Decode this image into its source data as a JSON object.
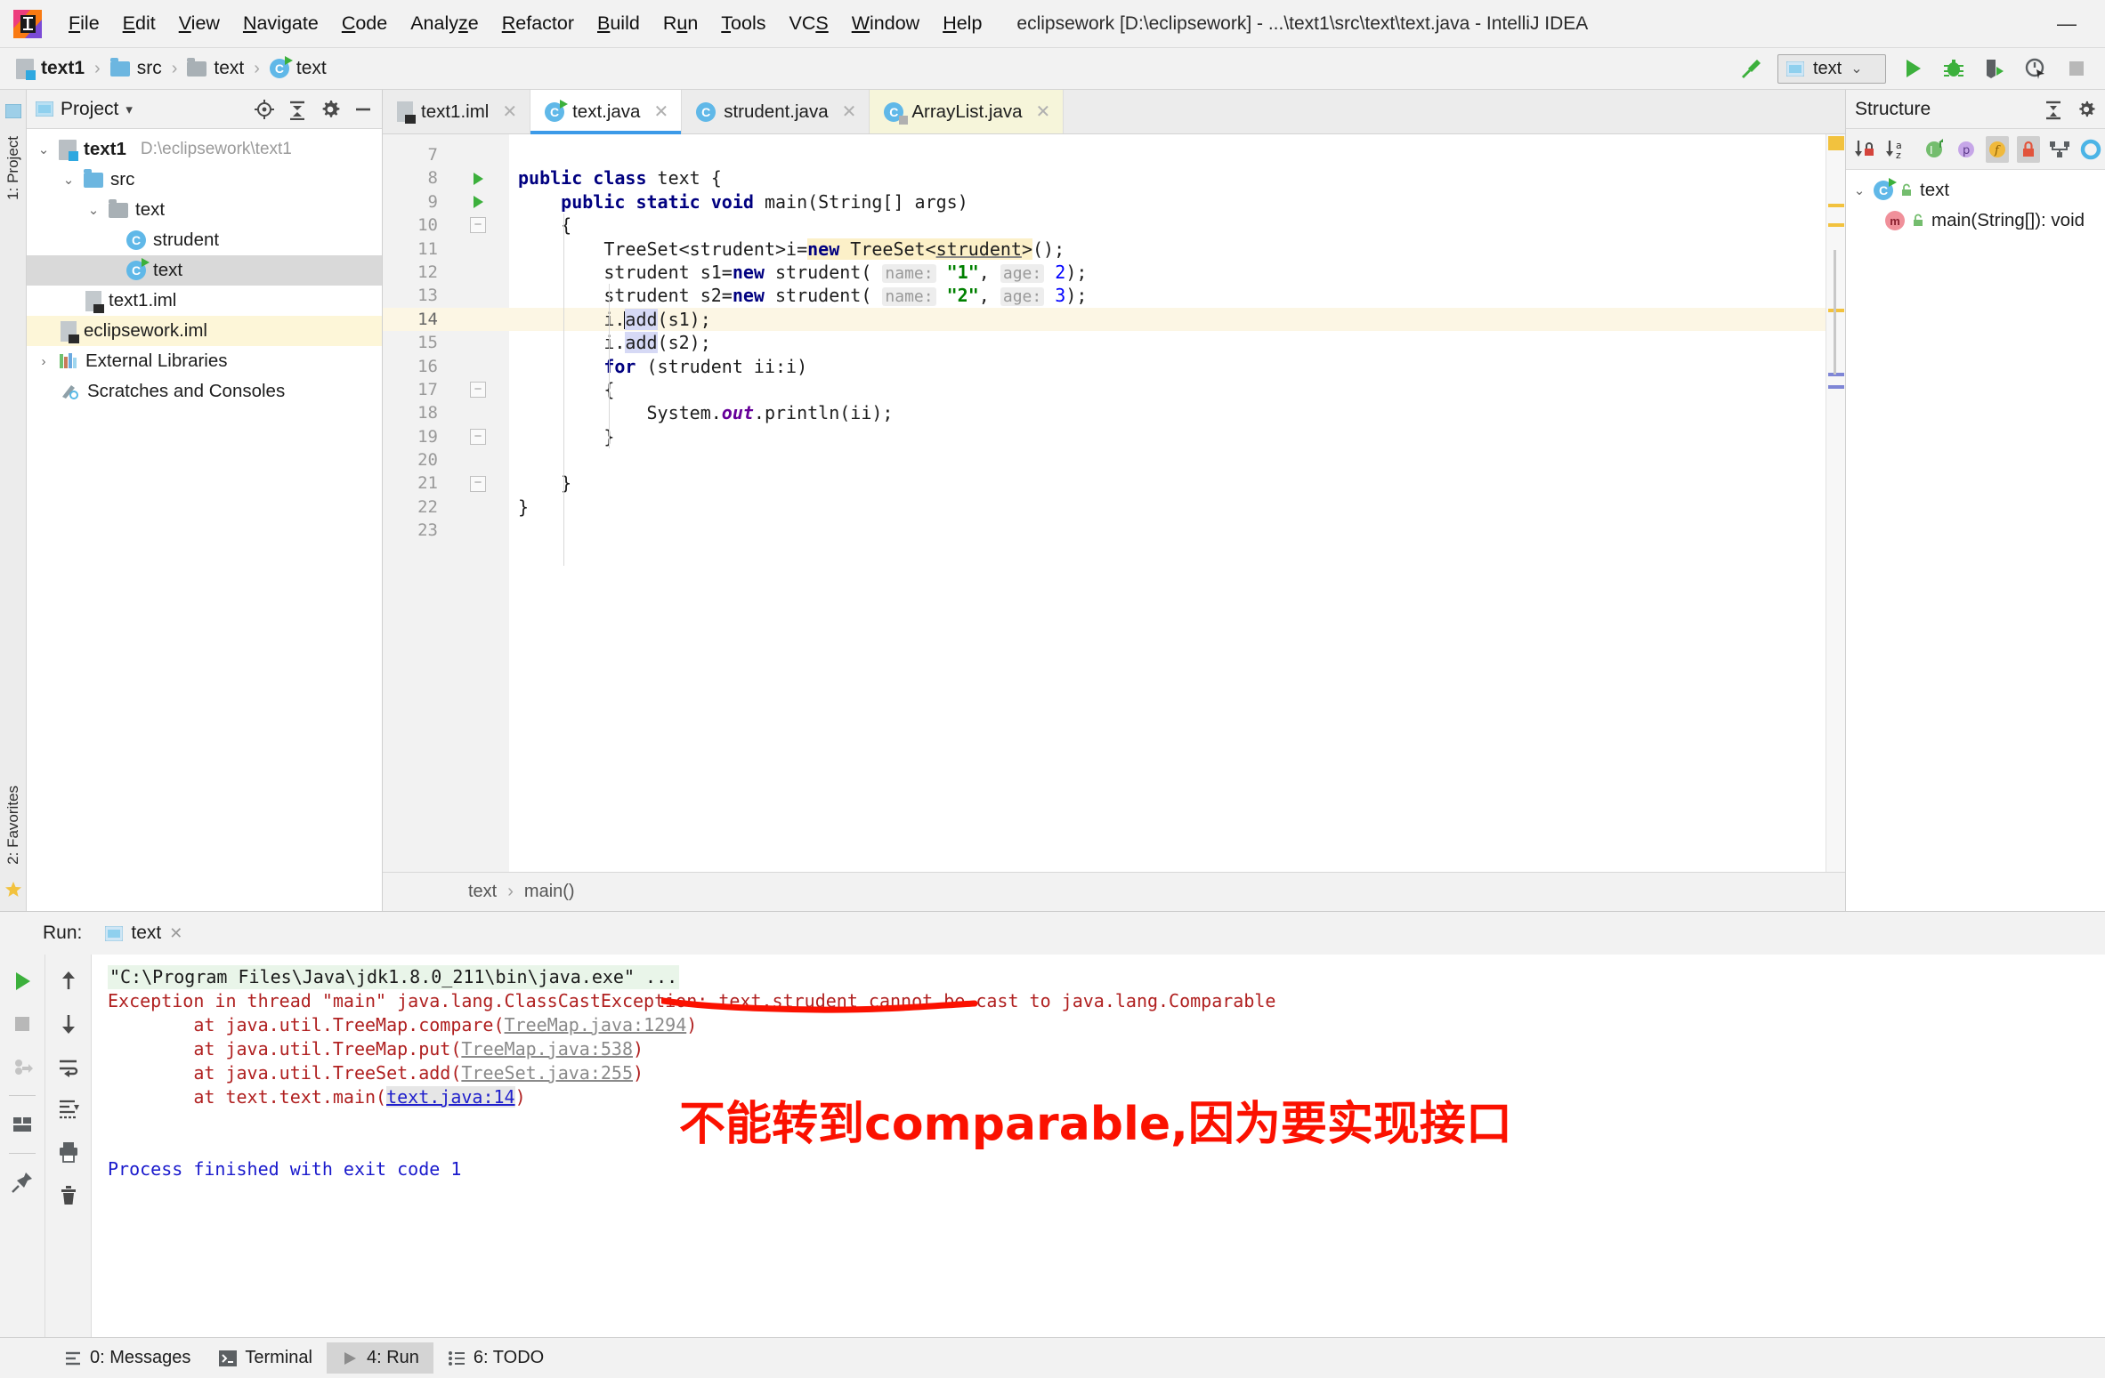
{
  "window": {
    "title": "eclipsework [D:\\eclipsework] - ...\\text1\\src\\text\\text.java - IntelliJ IDEA",
    "minimize_label": "—"
  },
  "menubar": {
    "items": [
      {
        "label": "File",
        "mnemonic": "F"
      },
      {
        "label": "Edit",
        "mnemonic": "E"
      },
      {
        "label": "View",
        "mnemonic": "V"
      },
      {
        "label": "Navigate",
        "mnemonic": "N"
      },
      {
        "label": "Code",
        "mnemonic": "C"
      },
      {
        "label": "Analyze",
        "mnemonic": "z"
      },
      {
        "label": "Refactor",
        "mnemonic": "R"
      },
      {
        "label": "Build",
        "mnemonic": "B"
      },
      {
        "label": "Run",
        "mnemonic": "u"
      },
      {
        "label": "Tools",
        "mnemonic": "T"
      },
      {
        "label": "VCS",
        "mnemonic": "S"
      },
      {
        "label": "Window",
        "mnemonic": "W"
      },
      {
        "label": "Help",
        "mnemonic": "H"
      }
    ]
  },
  "navbar": {
    "breadcrumbs": [
      {
        "label": "text1",
        "icon": "module-icon"
      },
      {
        "label": "src",
        "icon": "source-folder-icon"
      },
      {
        "label": "text",
        "icon": "package-icon"
      },
      {
        "label": "text",
        "icon": "java-class-icon"
      }
    ],
    "separator": "›",
    "build_icon": "hammer-icon",
    "run_config": {
      "name": "text",
      "icon": "application-icon",
      "chevron": "⌄"
    },
    "actions": [
      {
        "name": "run-button",
        "icon": "run-icon"
      },
      {
        "name": "debug-button",
        "icon": "debug-icon"
      },
      {
        "name": "run-with-coverage-button",
        "icon": "coverage-icon"
      },
      {
        "name": "profile-button",
        "icon": "profiler-icon"
      },
      {
        "name": "stop-button",
        "icon": "stop-icon"
      }
    ]
  },
  "left_rail": {
    "tabs": [
      "1: Project",
      "2: Favorites"
    ]
  },
  "project_panel": {
    "title": "Project",
    "chevron": "▾",
    "toolbar": [
      {
        "name": "locate-button",
        "icon": "crosshair-icon"
      },
      {
        "name": "collapse-all-button",
        "icon": "collapse-icon"
      },
      {
        "name": "settings-button",
        "icon": "gear-icon"
      },
      {
        "name": "hide-button",
        "icon": "minus-icon"
      }
    ],
    "tree": [
      {
        "label": "text1",
        "detail": "D:\\eclipsework\\text1",
        "icon": "module-icon",
        "depth": 0,
        "arrow": "⌄",
        "bold": true,
        "state": "normal"
      },
      {
        "label": "src",
        "detail": "",
        "icon": "source-folder-icon",
        "depth": 1,
        "arrow": "⌄",
        "bold": false,
        "state": "normal"
      },
      {
        "label": "text",
        "detail": "",
        "icon": "package-icon",
        "depth": 2,
        "arrow": "⌄",
        "bold": false,
        "state": "normal"
      },
      {
        "label": "strudent",
        "detail": "",
        "icon": "java-class-icon",
        "depth": 3,
        "arrow": "",
        "bold": false,
        "state": "normal"
      },
      {
        "label": "text",
        "detail": "",
        "icon": "java-runnable-class-icon",
        "depth": 3,
        "arrow": "",
        "bold": false,
        "state": "selected"
      },
      {
        "label": "text1.iml",
        "detail": "",
        "icon": "iml-file-icon",
        "depth": 2,
        "arrow": "",
        "bold": false,
        "state": "normal"
      },
      {
        "label": "eclipsework.iml",
        "detail": "",
        "icon": "iml-file-icon",
        "depth": 1,
        "arrow": "",
        "bold": false,
        "state": "highlight"
      },
      {
        "label": "External Libraries",
        "detail": "",
        "icon": "libraries-icon",
        "depth": 0,
        "arrow": "›",
        "bold": false,
        "state": "normal"
      },
      {
        "label": "Scratches and Consoles",
        "detail": "",
        "icon": "scratches-icon",
        "depth": 0,
        "arrow": "",
        "bold": false,
        "state": "normal"
      }
    ]
  },
  "editor": {
    "tabs": [
      {
        "label": "text1.iml",
        "icon": "iml-file-icon",
        "state": "normal",
        "close": "✕"
      },
      {
        "label": "text.java",
        "icon": "java-runnable-class-icon",
        "state": "active",
        "close": "✕"
      },
      {
        "label": "strudent.java",
        "icon": "java-class-icon",
        "state": "normal",
        "close": "✕"
      },
      {
        "label": "ArrayList.java",
        "icon": "java-library-class-icon",
        "state": "readonly",
        "close": "✕"
      }
    ],
    "first_line_number": 7,
    "current_line": 14,
    "lines": [
      {
        "n": 7,
        "text": ""
      },
      {
        "n": 8,
        "text": "public class text {",
        "gutter_icon": "run-class-icon"
      },
      {
        "n": 9,
        "text": "    public static void main(String[] args)",
        "gutter_icon": "run-method-icon"
      },
      {
        "n": 10,
        "text": "    {",
        "fold": "collapse"
      },
      {
        "n": 11,
        "text": "        TreeSet<strudent>i=new TreeSet<strudent>();"
      },
      {
        "n": 12,
        "text": "        strudent s1=new strudent( name: \"1\", age: 2);"
      },
      {
        "n": 13,
        "text": "        strudent s2=new strudent( name: \"2\", age: 3);"
      },
      {
        "n": 14,
        "text": "        i.add(s1);"
      },
      {
        "n": 15,
        "text": "        i.add(s2);"
      },
      {
        "n": 16,
        "text": "        for (strudent ii:i)"
      },
      {
        "n": 17,
        "text": "        {",
        "fold": "collapse"
      },
      {
        "n": 18,
        "text": "            System.out.println(ii);"
      },
      {
        "n": 19,
        "text": "        }",
        "fold": "collapse"
      },
      {
        "n": 20,
        "text": ""
      },
      {
        "n": 21,
        "text": "    }",
        "fold": "collapse"
      },
      {
        "n": 22,
        "text": "}"
      },
      {
        "n": 23,
        "text": ""
      }
    ],
    "hints": {
      "name": "name:",
      "age": "age:"
    },
    "breadcrumb": [
      "text",
      "main()"
    ],
    "breadcrumb_separator": "›"
  },
  "structure_panel": {
    "title": "Structure",
    "head_actions": [
      {
        "name": "expand-collapse-button",
        "icon": "expand-collapse-icon"
      },
      {
        "name": "settings-button",
        "icon": "gear-icon"
      }
    ],
    "toolbar": [
      {
        "name": "sort-by-visibility-button",
        "icon": "sort-visibility-icon",
        "active": false
      },
      {
        "name": "sort-alphabetically-button",
        "icon": "sort-alpha-icon",
        "active": false
      },
      {
        "name": "show-inherited-button",
        "icon": "inherited-icon",
        "active": false
      },
      {
        "name": "show-properties-button",
        "icon": "properties-icon",
        "active": false
      },
      {
        "name": "show-fields-button",
        "icon": "fields-icon",
        "active": true
      },
      {
        "name": "show-non-public-button",
        "icon": "lock-icon",
        "active": true
      },
      {
        "name": "show-hierarchy-button",
        "icon": "hierarchy-icon",
        "active": false
      },
      {
        "name": "autoscroll-button",
        "icon": "target-icon",
        "active": false
      }
    ],
    "tree": [
      {
        "label": "text",
        "icon": "java-runnable-class-icon",
        "badge": "public-lock-icon",
        "depth": 0,
        "arrow": "⌄"
      },
      {
        "label": "main(String[]): void",
        "icon": "method-icon",
        "badge": "public-lock-icon",
        "depth": 1,
        "arrow": ""
      }
    ]
  },
  "run_window": {
    "label": "Run:",
    "tab": {
      "label": "text",
      "icon": "application-icon",
      "close": "✕"
    },
    "left_tools": [
      {
        "name": "rerun-button",
        "icon": "run-icon"
      },
      {
        "name": "stop-button",
        "icon": "stop-icon"
      },
      {
        "name": "resume-button",
        "icon": "resume-icon"
      },
      {
        "name": "layout-button",
        "icon": "layout-icon"
      },
      {
        "name": "pin-tab-button",
        "icon": "pin-icon"
      }
    ],
    "right_tools": [
      {
        "name": "up-button",
        "icon": "arrow-up-icon"
      },
      {
        "name": "down-button",
        "icon": "arrow-down-icon"
      },
      {
        "name": "soft-wrap-button",
        "icon": "soft-wrap-icon"
      },
      {
        "name": "scroll-to-end-button",
        "icon": "scroll-end-icon"
      },
      {
        "name": "print-button",
        "icon": "printer-icon"
      },
      {
        "name": "clear-all-button",
        "icon": "trash-icon"
      }
    ],
    "console": {
      "command": "\"C:\\Program Files\\Java\\jdk1.8.0_211\\bin\\java.exe\" ...",
      "exception": "Exception in thread \"main\" java.lang.ClassCastException: text.strudent cannot be cast to java.lang.Comparable",
      "stack": [
        {
          "prefix": "\tat java.util.TreeMap.compare(",
          "link": "TreeMap.java:1294",
          "suffix": ")",
          "highlight": false
        },
        {
          "prefix": "\tat java.util.TreeMap.put(",
          "link": "TreeMap.java:538",
          "suffix": ")",
          "highlight": false
        },
        {
          "prefix": "\tat java.util.TreeSet.add(",
          "link": "TreeSet.java:255",
          "suffix": ")",
          "highlight": false
        },
        {
          "prefix": "\tat text.text.main(",
          "link": "text.java:14",
          "suffix": ")",
          "highlight": true
        }
      ],
      "result": "Process finished with exit code 1"
    },
    "annotation": {
      "text": "不能转到comparable,因为要实现接口",
      "color": "#fb1100"
    }
  },
  "statusbar": {
    "items": [
      {
        "label": "0: Messages",
        "icon": "messages-icon",
        "active": false
      },
      {
        "label": "Terminal",
        "icon": "terminal-icon",
        "active": false
      },
      {
        "label": "4: Run",
        "icon": "run-icon",
        "active": true
      },
      {
        "label": "6: TODO",
        "icon": "todo-icon",
        "active": false
      }
    ]
  },
  "colors": {
    "accent": "#3c9ae8",
    "run_green": "#3cb03c",
    "error_red": "#b02020",
    "annotation_red": "#fb1100",
    "highlight_yellow": "#fcf0c8"
  }
}
